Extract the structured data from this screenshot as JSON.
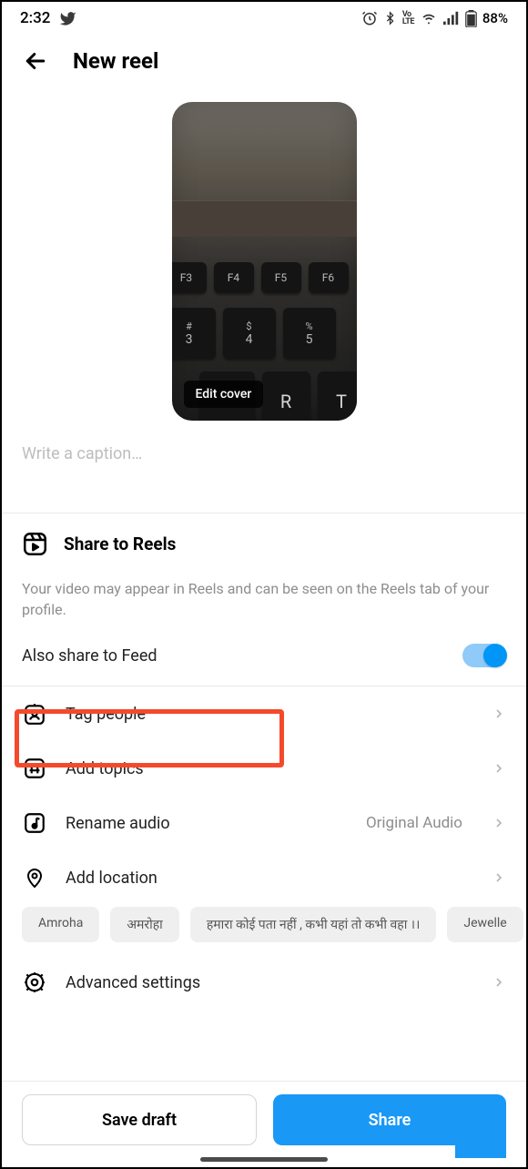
{
  "status": {
    "time": "2:32",
    "battery": "88%",
    "lte_label": "VoLTE"
  },
  "header": {
    "title": "New reel"
  },
  "cover": {
    "edit_label": "Edit cover"
  },
  "caption": {
    "placeholder": "Write a caption…"
  },
  "share": {
    "title": "Share to Reels",
    "description": "Your video may appear in Reels and can be seen on the Reels tab of your profile.",
    "feed_label": "Also share to Feed",
    "feed_on": true
  },
  "menu": {
    "tag_people": "Tag people",
    "add_topics": "Add topics",
    "rename_audio": "Rename audio",
    "rename_audio_value": "Original Audio",
    "add_location": "Add location",
    "advanced": "Advanced settings"
  },
  "location_chips": [
    "Amroha",
    "अमरोहा",
    "हमारा कोई पता नहीं , कभी यहां तो कभी वहा ।।",
    "Jewelle"
  ],
  "buttons": {
    "save_draft": "Save draft",
    "share": "Share"
  }
}
